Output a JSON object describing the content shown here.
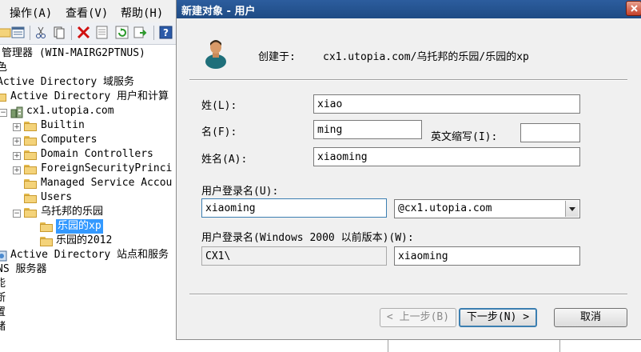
{
  "menu": {
    "items": [
      "操作(A)",
      "查看(V)",
      "帮助(H)"
    ]
  },
  "toolbar": {
    "icons": [
      "folder-view-icon",
      "list-view-icon",
      "cut-icon",
      "copy-icon",
      "delete-icon",
      "properties-icon",
      "refresh-icon",
      "export-icon",
      "help-icon"
    ]
  },
  "tree": {
    "root": "管理器 (WIN-MAIRG2PTNUS)",
    "role": "色",
    "adds": "Active Directory 域服务",
    "aduc": "Active Directory 用户和计算",
    "domain": "cx1.utopia.com",
    "builtin": "Builtin",
    "computers": "Computers",
    "dc": "Domain Controllers",
    "fsp": "ForeignSecurityPrinci",
    "msa": "Managed Service Accou",
    "users": "Users",
    "ou": "乌托邦的乐园",
    "ou_xp": "乐园的xp",
    "ou_2012": "乐园的2012",
    "sites": "Active Directory 站点和服务",
    "dns": "NS 服务器",
    "c1": "能",
    "c2": "断",
    "c3": "置",
    "c4": "储"
  },
  "dialog": {
    "title": "新建对象 - 用户",
    "created_in_label": "创建于:",
    "created_in_path": "cx1.utopia.com/乌托邦的乐园/乐园的xp",
    "last_name_label": "姓(L):",
    "last_name_value": "xiao",
    "first_name_label": "名(F):",
    "first_name_value": "ming",
    "initials_label": "英文缩写(I):",
    "initials_value": "",
    "full_name_label": "姓名(A):",
    "full_name_value": "xiaoming",
    "logon_label": "用户登录名(U):",
    "logon_value": "xiaoming",
    "domain_suffix": "@cx1.utopia.com",
    "pre2000_label": "用户登录名(Windows 2000 以前版本)(W):",
    "pre2000_domain": "CX1\\",
    "pre2000_value": "xiaoming",
    "back_button": "< 上一步(B)",
    "next_button": "下一步(N) >",
    "cancel_button": "取消"
  },
  "colors": {
    "titlebar": "#1f4b84",
    "selection": "#3399ff",
    "folder": "#f4d37a"
  }
}
